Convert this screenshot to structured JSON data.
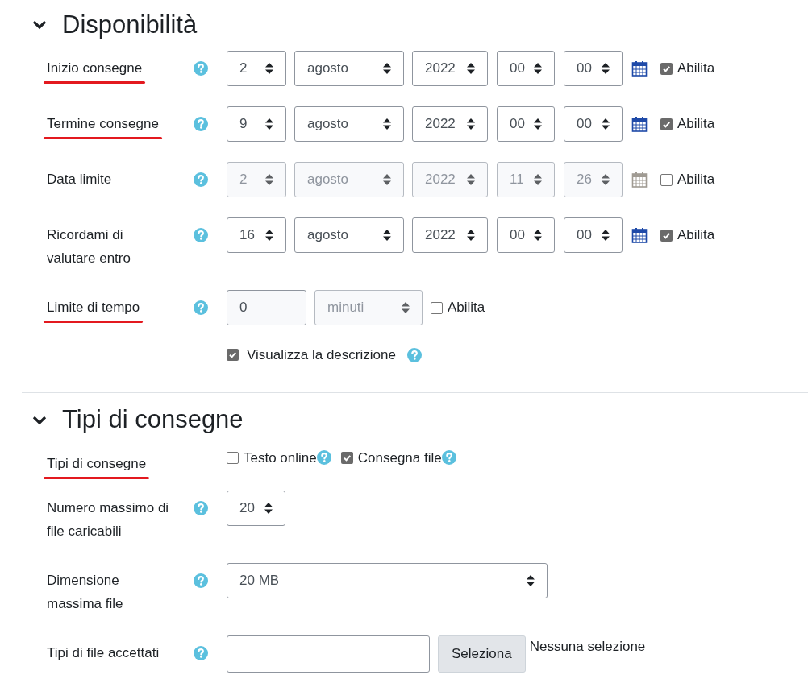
{
  "sections": [
    {
      "title": "Disponibilità",
      "expanded": true,
      "rows": [
        {
          "kind": "date",
          "label": "Inizio consegne",
          "underlined": true,
          "help": true,
          "day": "2",
          "month": "agosto",
          "year": "2022",
          "hour": "00",
          "minute": "00",
          "enable_label": "Abilita",
          "enabled": true
        },
        {
          "kind": "date",
          "label": "Termine consegne",
          "underlined": true,
          "help": true,
          "day": "9",
          "month": "agosto",
          "year": "2022",
          "hour": "00",
          "minute": "00",
          "enable_label": "Abilita",
          "enabled": true
        },
        {
          "kind": "date",
          "label": "Data limite",
          "underlined": false,
          "help": true,
          "day": "2",
          "month": "agosto",
          "year": "2022",
          "hour": "11",
          "minute": "26",
          "enable_label": "Abilita",
          "enabled": false
        },
        {
          "kind": "date",
          "label": "Ricordami di valutare entro",
          "underlined": false,
          "help": true,
          "day": "16",
          "month": "agosto",
          "year": "2022",
          "hour": "00",
          "minute": "00",
          "enable_label": "Abilita",
          "enabled": true
        },
        {
          "kind": "duration",
          "label": "Limite di tempo",
          "underlined": true,
          "help": true,
          "value": "0",
          "unit": "minuti",
          "enable_label": "Abilita",
          "enabled": false
        },
        {
          "kind": "checkbox",
          "text": "Visualizza la descrizione",
          "checked": true,
          "help": true
        }
      ]
    },
    {
      "title": "Tipi di consegne",
      "expanded": true,
      "rows": [
        {
          "kind": "checkgroup",
          "label": "Tipi di consegne",
          "underlined": true,
          "options": [
            {
              "text": "Testo online",
              "checked": false,
              "help": true
            },
            {
              "text": "Consegna file",
              "checked": true,
              "help": true
            }
          ]
        },
        {
          "kind": "count",
          "label": "Numero massimo di file caricabili",
          "underlined": false,
          "help": true,
          "value": "20"
        },
        {
          "kind": "select",
          "label": "Dimensione massima file",
          "underlined": false,
          "help": true,
          "value": "20 MB"
        },
        {
          "kind": "filetypes",
          "label": "Tipi di file accettati",
          "underlined": false,
          "help": true,
          "button": "Seleziona",
          "status": "Nessuna selezione"
        }
      ]
    }
  ]
}
